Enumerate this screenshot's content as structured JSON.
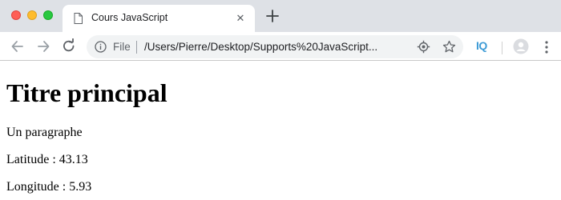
{
  "browser": {
    "tab": {
      "title": "Cours JavaScript",
      "close_glyph": "✕",
      "doc_icon": "document-icon"
    },
    "new_tab_icon": "plus-icon",
    "toolbar": {
      "back_icon": "arrow-left-icon",
      "forward_icon": "arrow-right-icon",
      "reload_icon": "reload-icon",
      "omnibox": {
        "scheme_label": "File",
        "url": "/Users/Pierre/Desktop/Supports%20JavaScript..."
      },
      "extension_label": "IQ"
    }
  },
  "content": {
    "heading": "Titre principal",
    "paragraph": "Un paragraphe",
    "latitude": "Latitude : 43.13",
    "longitude": "Longitude : 5.93"
  },
  "colors": {
    "tabstrip_bg": "#dee1e6",
    "omnibox_bg": "#f1f3f4",
    "extension_accent": "#3d9bd6",
    "close_red": "#fe5f57",
    "minimize_yellow": "#febc2e",
    "zoom_green": "#28c840"
  }
}
